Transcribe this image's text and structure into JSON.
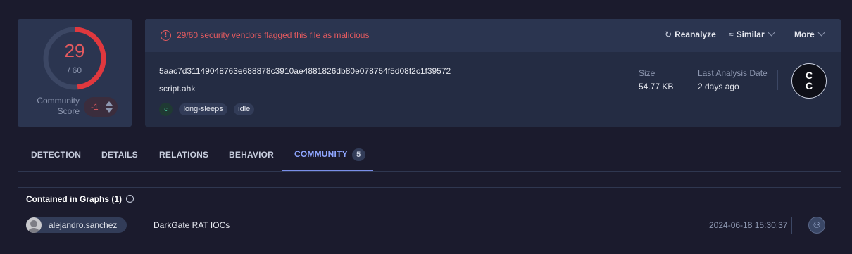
{
  "score": {
    "detections": "29",
    "total": "/ 60",
    "detection_ratio": 0.483,
    "community_label_1": "Community",
    "community_label_2": "Score",
    "community_value": "-1"
  },
  "alert": {
    "text": "29/60 security vendors flagged this file as malicious",
    "icon": "alert-circle-icon"
  },
  "actions": {
    "reanalyze": "Reanalyze",
    "similar": "Similar",
    "more": "More"
  },
  "file": {
    "hash": "5aac7d31149048763e688878c3910ae4881826db80e078754f5d08f2c1f39572",
    "name": "script.ahk",
    "tag_icon": "c",
    "tags": [
      "long-sleeps",
      "idle"
    ],
    "size_label": "Size",
    "size_value": "54.77 KB",
    "analysis_label": "Last Analysis Date",
    "analysis_value": "2 days ago",
    "type_icon_line1": "C",
    "type_icon_line2": "C"
  },
  "tabs": [
    {
      "label": "DETECTION"
    },
    {
      "label": "DETAILS"
    },
    {
      "label": "RELATIONS"
    },
    {
      "label": "BEHAVIOR"
    },
    {
      "label": "COMMUNITY",
      "badge": "5",
      "active": true
    }
  ],
  "graphs": {
    "title": "Contained in Graphs  (1)",
    "info_icon": "i",
    "rows": [
      {
        "user": "alejandro.sanchez",
        "graph_name": "DarkGate RAT IOCs",
        "date": "2024-06-18 15:30:37",
        "icon": "graph-icon"
      }
    ]
  },
  "colors": {
    "background": "#1b1b2d",
    "card": "#242c43",
    "card_header": "#2b3550",
    "malicious_red": "#e45a5f",
    "accent_blue": "#8fa6ff"
  }
}
